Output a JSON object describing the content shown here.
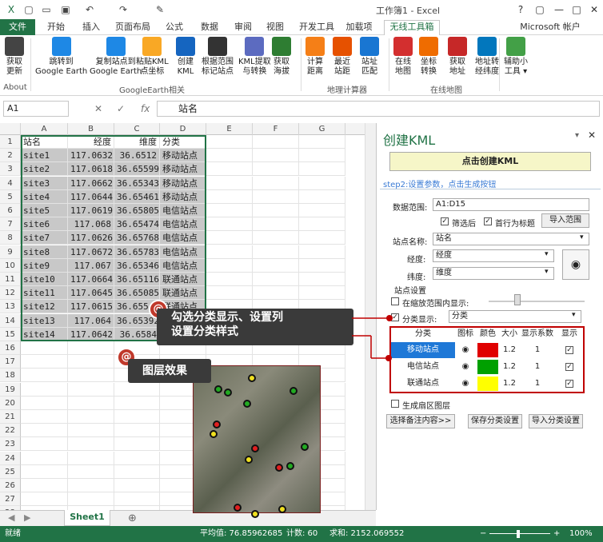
{
  "window": {
    "title": "工作簿1 - Excel",
    "help": "?",
    "min": "—",
    "max": "□",
    "close": "✕",
    "restore": "▢"
  },
  "menu": {
    "file": "文件",
    "items": [
      "开始",
      "插入",
      "页面布局",
      "公式",
      "数据",
      "审阅",
      "视图",
      "开发工具",
      "加载项",
      "无线工具箱"
    ],
    "account": "Microsoft 帐户"
  },
  "ribbon": {
    "buttons": [
      {
        "label": "获取\n更新",
        "color": "#444"
      },
      {
        "label": "跳转到\nGoogle Earth",
        "color": "#1e88e5"
      },
      {
        "label": "复制站点到\nGoogle Earth",
        "color": "#1e88e5"
      },
      {
        "label": "粘贴KML\n点坐标",
        "color": "#f9a825"
      },
      {
        "label": "创建\nKML",
        "color": "#1565c0"
      },
      {
        "label": "根据范围\n标记站点",
        "color": "#333"
      },
      {
        "label": "KML提取\n与转换",
        "color": "#5c6bc0"
      },
      {
        "label": "获取\n海拔",
        "color": "#2e7d32"
      },
      {
        "label": "计算\n距离",
        "color": "#f57f17"
      },
      {
        "label": "最近\n站距",
        "color": "#e65100"
      },
      {
        "label": "站址\n匹配",
        "color": "#1976d2"
      },
      {
        "label": "在线\n地图",
        "color": "#d32f2f"
      },
      {
        "label": "坐标\n转换",
        "color": "#ef6c00"
      },
      {
        "label": "获取\n地址",
        "color": "#c62828"
      },
      {
        "label": "地址转\n经纬度",
        "color": "#0277bd"
      },
      {
        "label": "辅助小\n工具 ▾",
        "color": "#43a047"
      }
    ],
    "groups": [
      "About",
      "GoogleEarth相关",
      "地理计算器",
      "在线地图"
    ]
  },
  "formula": {
    "namebox": "A1",
    "fx": "fx",
    "cancel": "✕",
    "enter": "✓",
    "value": "站名"
  },
  "sheet": {
    "columns": [
      "A",
      "B",
      "C",
      "D",
      "E",
      "F",
      "G"
    ],
    "header": [
      "站名",
      "经度",
      "维度",
      "分类"
    ],
    "rows": [
      [
        "site1",
        "117.0632",
        "36.6512",
        "移动站点"
      ],
      [
        "site2",
        "117.0618",
        "36.65599",
        "移动站点"
      ],
      [
        "site3",
        "117.0662",
        "36.65343",
        "移动站点"
      ],
      [
        "site4",
        "117.0644",
        "36.65461",
        "移动站点"
      ],
      [
        "site5",
        "117.0619",
        "36.65805",
        "电信站点"
      ],
      [
        "site6",
        "117.068",
        "36.65474",
        "电信站点"
      ],
      [
        "site7",
        "117.0626",
        "36.65768",
        "电信站点"
      ],
      [
        "site8",
        "117.0672",
        "36.65783",
        "电信站点"
      ],
      [
        "site9",
        "117.067",
        "36.65346",
        "电信站点"
      ],
      [
        "site10",
        "117.0664",
        "36.65116",
        "联通站点"
      ],
      [
        "site11",
        "117.0645",
        "36.65085",
        "联通站点"
      ],
      [
        "site12",
        "117.0615",
        "36.65541",
        "联通站点"
      ],
      [
        "site13",
        "117.064",
        "36.65392",
        "联通站点"
      ],
      [
        "site14",
        "117.0642",
        "36.6584",
        "联通站点"
      ]
    ],
    "tab": "Sheet1"
  },
  "panel": {
    "title": "创建KML",
    "create_button": "点击创建KML",
    "step2": "step2:设置参数，点击生成按钮",
    "range_label": "数据范围:",
    "range_value": "A1:D15",
    "filter_label": "筛选后",
    "header_label": "首行为标题",
    "import_range": "导入范围",
    "site_name_label": "站点名称:",
    "site_name_value": "站名",
    "lng_label": "经度:",
    "lng_value": "经度",
    "lat_label": "纬度:",
    "lat_value": "维度",
    "site_settings": "站点设置",
    "zoom_show": "在缩放范围内显示:",
    "category_show": "分类显示:",
    "category_value": "分类",
    "table_head": [
      "分类",
      "图标",
      "颜色",
      "大小",
      "显示系数",
      "显示"
    ],
    "categories": [
      {
        "name": "移动站点",
        "color": "#e00000",
        "size": "1.2",
        "factor": "1"
      },
      {
        "name": "电信站点",
        "color": "#00a000",
        "size": "1.2",
        "factor": "1"
      },
      {
        "name": "联通站点",
        "color": "#ffff00",
        "size": "1.2",
        "factor": "1"
      }
    ],
    "sector_layer": "生成扇区图层",
    "select_note": "选择备注内容>>",
    "save_cat": "保存分类设置",
    "import_cat": "导入分类设置"
  },
  "callouts": {
    "c1_line1": "勾选分类显示、设置列",
    "c1_line2": "设置分类样式",
    "c2": "图层效果",
    "at": "@"
  },
  "status": {
    "ready": "就绪",
    "avg": "平均值: 76.85962685",
    "count": "计数: 60",
    "sum": "求和: 2152.069552",
    "zoom": "100%"
  }
}
